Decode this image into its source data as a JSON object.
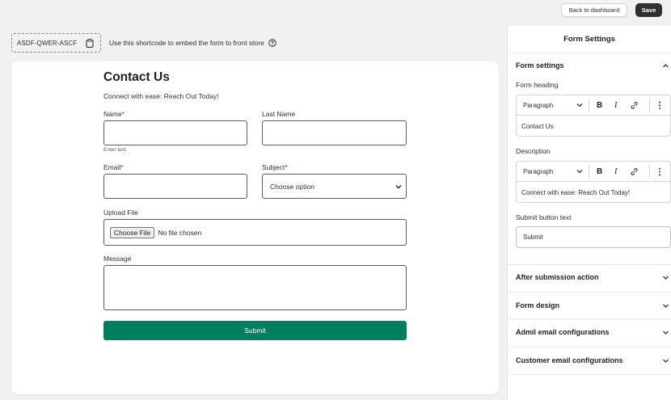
{
  "header": {
    "back_label": "Back to dashboard",
    "save_label": "Save"
  },
  "shortcode": {
    "code": "ASDF-QWER-ASCF",
    "hint": "Use this shortcode to embed the form to front store"
  },
  "form": {
    "title": "Contact Us",
    "description": "Connect with ease: Reach Out Today!",
    "fields": {
      "name_label": "Name",
      "name_hint": "Enter text",
      "last_name_label": "Last Name",
      "email_label": "Email",
      "subject_label": "Subject",
      "subject_value": "Choose option",
      "upload_label": "Upload File",
      "file_button": "Choose File",
      "file_status": "No file chosen",
      "message_label": "Message",
      "required_mark": "*"
    },
    "submit_label": "Submit"
  },
  "panel": {
    "title": "Form Settings",
    "form_settings": {
      "section_title": "Form settings",
      "heading_label": "Form heading",
      "heading_format": "Paragraph",
      "heading_value": "Contact Us",
      "description_label": "Description",
      "description_format": "Paragraph",
      "description_value": "Connect with ease: Reach Out Today!",
      "submit_text_label": "Submit button text",
      "submit_text_value": "Submit",
      "bold": "B",
      "italic": "I"
    },
    "sections": [
      {
        "label": "After submission action"
      },
      {
        "label": "Form design"
      },
      {
        "label": "Admil email configurations"
      },
      {
        "label": "Customer email configurations"
      }
    ]
  },
  "colors": {
    "accent": "#007f5f",
    "save_bg": "#303030"
  }
}
